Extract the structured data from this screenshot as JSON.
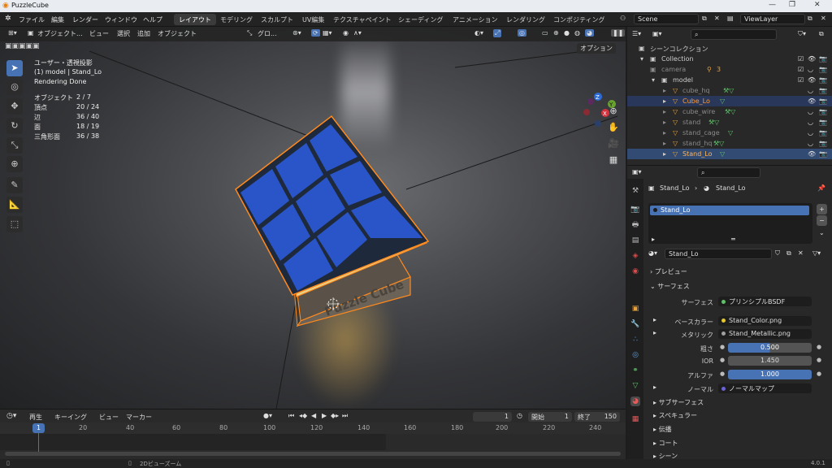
{
  "titlebar": {
    "title": "PuzzleCube",
    "min": "—",
    "max": "❐",
    "close": "✕"
  },
  "menu": {
    "file": "ファイル",
    "edit": "編集",
    "render": "レンダー",
    "window": "ウィンドウ",
    "help": "ヘルプ"
  },
  "workspaces": [
    "レイアウト",
    "モデリング",
    "スカルプト",
    "UV編集",
    "テクスチャペイント",
    "シェーディング",
    "アニメーション",
    "レンダリング",
    "コンポジティング"
  ],
  "scene": {
    "name": "Scene",
    "view_layer": "ViewLayer"
  },
  "viewport": {
    "mode": "オブジェクト...",
    "view": "ビュー",
    "select": "選択",
    "add": "追加",
    "object": "オブジェクト",
    "orientation": "グロ...",
    "options": "オプション",
    "overlay_title": "ユーザー・透視投影",
    "overlay_sub": "(1) model | Stand_Lo",
    "overlay_status": "Rendering Done",
    "stats": [
      {
        "label": "オブジェクト",
        "value": "2 / 7"
      },
      {
        "label": "頂点",
        "value": "20 / 24"
      },
      {
        "label": "辺",
        "value": "36 / 40"
      },
      {
        "label": "面",
        "value": "18 / 19"
      },
      {
        "label": "三角形面",
        "value": "36 / 38"
      }
    ],
    "stand_text": "Puzzle Cube",
    "gizmo": {
      "z": "Z",
      "y": "Y",
      "x": "X"
    }
  },
  "timeline": {
    "play": "再生",
    "keying": "キーイング",
    "view": "ビュー",
    "marker": "マーカー",
    "current": "1",
    "start_label": "開始",
    "start": "1",
    "end_label": "終了",
    "end": "150",
    "ticks": [
      "20",
      "40",
      "60",
      "80",
      "100",
      "120",
      "140",
      "160",
      "180",
      "200",
      "220",
      "240"
    ],
    "playhead": "1"
  },
  "status": {
    "zoom_hint": "2Dビューズーム",
    "version": "4.0.1"
  },
  "outliner": {
    "search_placeholder": "",
    "scene_collection": "シーンコレクション",
    "collection": "Collection",
    "items": [
      {
        "name": "camera",
        "dim": true
      },
      {
        "name": "model",
        "dim": false
      },
      {
        "name": "cube_hq",
        "dim": true
      },
      {
        "name": "Cube_Lo",
        "dim": false,
        "highlight": true
      },
      {
        "name": "cube_wire",
        "dim": true
      },
      {
        "name": "stand",
        "dim": true
      },
      {
        "name": "stand_cage",
        "dim": true
      },
      {
        "name": "stand_hq",
        "dim": true
      },
      {
        "name": "Stand_Lo",
        "dim": false,
        "selected": true
      }
    ],
    "camera_badge": "3"
  },
  "properties": {
    "breadcrumb_obj": "Stand_Lo",
    "breadcrumb_mat": "Stand_Lo",
    "slot": "Stand_Lo",
    "material": "Stand_Lo",
    "preview": "プレビュー",
    "surface_section": "サーフェス",
    "surface_label": "サーフェス",
    "surface_value": "プリンシプルBSDF",
    "base_color_label": "ベースカラー",
    "base_color_value": "Stand_Color.png",
    "metallic_label": "メタリック",
    "metallic_value": "Stand_Metallic.png",
    "roughness_label": "粗さ",
    "roughness_value": "0.500",
    "ior_label": "IOR",
    "ior_value": "1.450",
    "alpha_label": "アルファ",
    "alpha_value": "1.000",
    "normal_label": "ノーマル",
    "normal_value": "ノーマルマップ",
    "subsections": [
      "サブサーフェス",
      "スペキュラー",
      "伝播",
      "コート",
      "シーン"
    ]
  },
  "colors": {
    "accent": "#4772b3",
    "selection": "#ff8a1e",
    "cube_blue": "#2a55c8",
    "cube_yellow": "#e7d38a"
  }
}
